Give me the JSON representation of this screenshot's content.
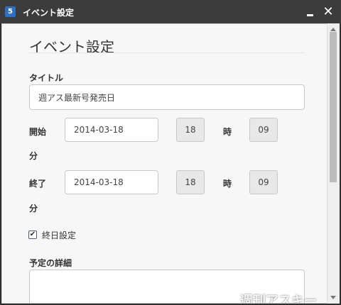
{
  "window": {
    "app_icon": "5",
    "title": "イベント設定"
  },
  "form": {
    "heading": "イベント設定",
    "title_label": "タイトル",
    "title_value": "週アス最新号発売日",
    "start": {
      "label": "開始",
      "date": "2014-03-18",
      "hour": "18",
      "hour_unit": "時",
      "minute": "09",
      "minute_unit": "分"
    },
    "end": {
      "label": "終了",
      "date": "2014-03-18",
      "hour": "18",
      "hour_unit": "時",
      "minute": "09",
      "minute_unit": "分"
    },
    "all_day": {
      "label": "終日設定",
      "checked": true
    },
    "details_label": "予定の詳細",
    "details_value": ""
  },
  "watermark": "週刊アスキー",
  "icons": [
    "app-icon",
    "minimize-icon",
    "close-icon",
    "checkbox-check-icon",
    "scroll-up-icon",
    "scroll-down-icon"
  ]
}
